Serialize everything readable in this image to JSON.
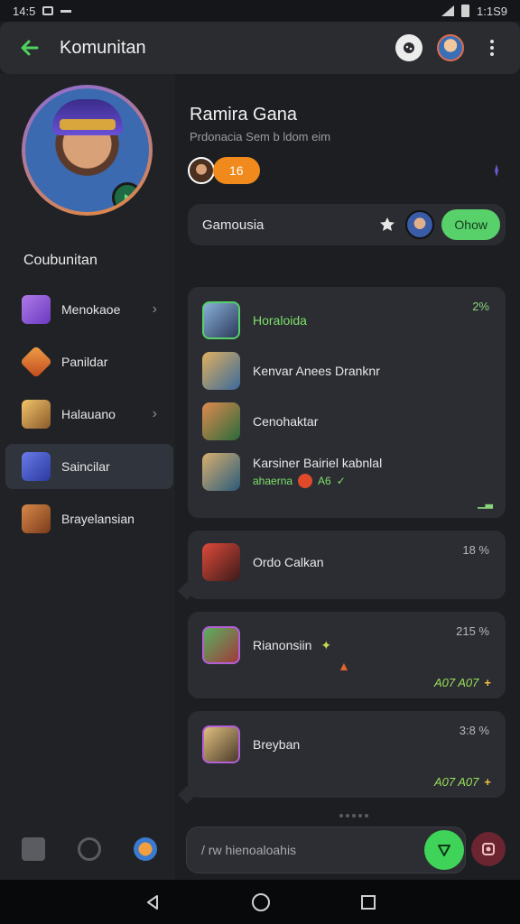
{
  "status": {
    "time": "14:5",
    "battery": "1:1S9"
  },
  "appbar": {
    "title": "Komunitan"
  },
  "sidebar": {
    "section_title": "Coubunitan",
    "items": [
      {
        "label": "Menokaoe",
        "has_chevron": true,
        "color": "#8a5ad6"
      },
      {
        "label": "Panildar",
        "has_chevron": false,
        "color": "#d8762c"
      },
      {
        "label": "Halauano",
        "has_chevron": true,
        "color": "#c9963c"
      },
      {
        "label": "Saincilar",
        "has_chevron": false,
        "color": "#4a5ac8",
        "active": true
      },
      {
        "label": "Brayelansian",
        "has_chevron": false,
        "color": "#b56a2c"
      }
    ]
  },
  "profile": {
    "name": "Ramira Gana",
    "subtitle": "Prdonacia Sem b ldom eim",
    "badge": "16"
  },
  "search": {
    "label": "Gamousia",
    "button": "Ohow"
  },
  "cards": [
    {
      "percent": "2%",
      "rows": [
        {
          "title": "Horaloida"
        },
        {
          "title": "Kenvar Anees Dranknr"
        },
        {
          "title": "Cenohaktar"
        },
        {
          "title": "Karsiner Bairiel kabnlal",
          "sub": "ahaerna",
          "sub2": "A6"
        }
      ]
    },
    {
      "percent": "18 %",
      "title": "Ordo Calkan"
    },
    {
      "percent": "215 %",
      "title": "Rianonsiin",
      "footer": "A07 A07"
    },
    {
      "percent": "3:8 %",
      "title": "Breyban",
      "footer": "A07 A07"
    }
  ],
  "composer": {
    "placeholder": "/ rw hienoaloahis"
  }
}
